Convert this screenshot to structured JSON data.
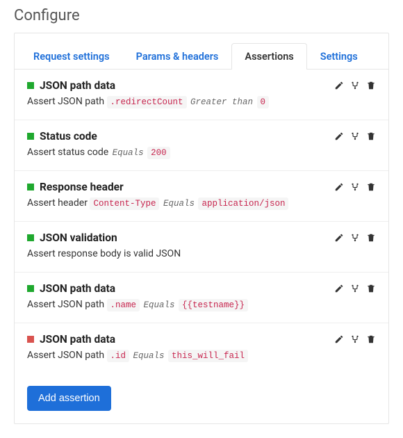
{
  "page_title": "Configure",
  "tabs": {
    "request_settings": "Request settings",
    "params_headers": "Params & headers",
    "assertions": "Assertions",
    "settings": "Settings"
  },
  "assertions": [
    {
      "status": "pass",
      "title": "JSON path data",
      "desc_prefix": "Assert JSON path",
      "path": ".redirectCount",
      "comparison": "Greater than",
      "target": "0"
    },
    {
      "status": "pass",
      "title": "Status code",
      "desc_prefix": "Assert status code",
      "path": "",
      "comparison": "Equals",
      "target": "200"
    },
    {
      "status": "pass",
      "title": "Response header",
      "desc_prefix": "Assert header",
      "path": "Content-Type",
      "comparison": "Equals",
      "target": "application/json"
    },
    {
      "status": "pass",
      "title": "JSON validation",
      "desc_prefix": "Assert response body is valid JSON",
      "path": "",
      "comparison": "",
      "target": ""
    },
    {
      "status": "pass",
      "title": "JSON path data",
      "desc_prefix": "Assert JSON path",
      "path": ".name",
      "comparison": "Equals",
      "target": "{{testname}}"
    },
    {
      "status": "fail",
      "title": "JSON path data",
      "desc_prefix": "Assert JSON path",
      "path": ".id",
      "comparison": "Equals",
      "target": "this_will_fail"
    }
  ],
  "add_button": "Add assertion"
}
